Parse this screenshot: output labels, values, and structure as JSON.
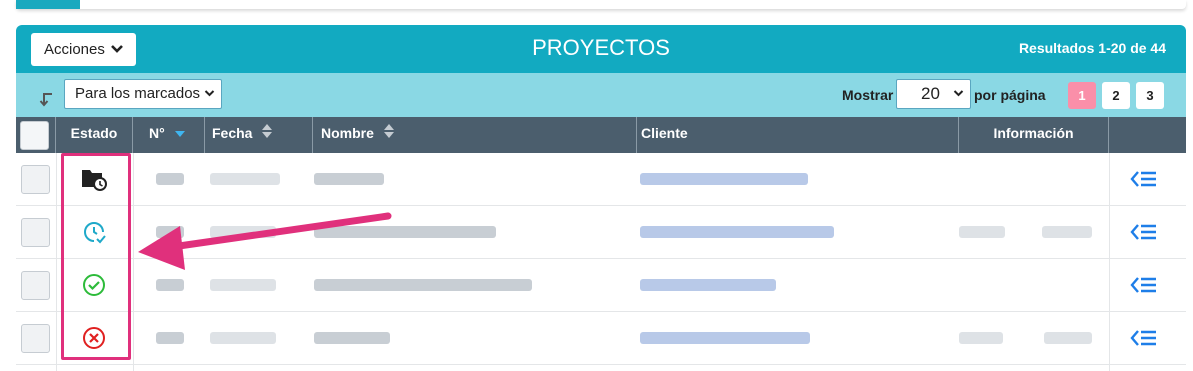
{
  "toolbar": {
    "actions_label": "Acciones",
    "title": "PROYECTOS",
    "results": "Resultados 1-20 de 44"
  },
  "subtoolbar": {
    "bulk_select_value": "Para los marcados",
    "show_label": "Mostrar",
    "per_page_value": "20",
    "per_page_suffix": "por página",
    "pages": [
      "1",
      "2",
      "3"
    ],
    "active_page": "1"
  },
  "table": {
    "columns": {
      "estado": "Estado",
      "numero": "N°",
      "fecha": "Fecha",
      "nombre": "Nombre",
      "cliente": "Cliente",
      "informacion": "Información"
    },
    "rows": [
      {
        "estado_icon": "folder-clock-icon"
      },
      {
        "estado_icon": "clock-check-icon"
      },
      {
        "estado_icon": "check-circle-icon"
      },
      {
        "estado_icon": "x-circle-icon"
      }
    ]
  },
  "colors": {
    "header_bg": "#12aac1",
    "subheader_bg": "#8ad8e4",
    "table_head_bg": "#4b5e6d",
    "active_page": "#fa8fa9",
    "annotation": "#e0307c",
    "link_blue": "#1e7ee8"
  }
}
